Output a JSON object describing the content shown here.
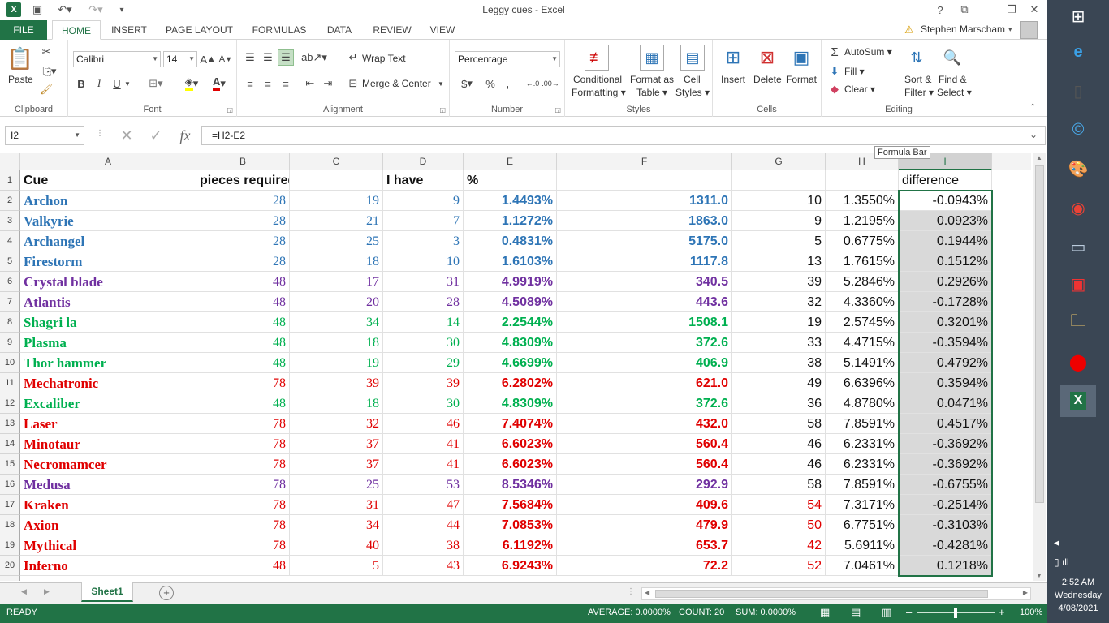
{
  "window": {
    "title": "Leggy cues - Excel"
  },
  "quick_access": {
    "logo": "X"
  },
  "title_controls": {
    "help": "?",
    "restore": "⧉",
    "minimize": "–",
    "maximize": "❐",
    "close": "✕"
  },
  "tabs": [
    "FILE",
    "HOME",
    "INSERT",
    "PAGE LAYOUT",
    "FORMULAS",
    "DATA",
    "REVIEW",
    "VIEW"
  ],
  "user": {
    "name": "Stephen Marscham"
  },
  "ribbon": {
    "clipboard": {
      "label": "Clipboard",
      "paste": "Paste"
    },
    "font": {
      "label": "Font",
      "name": "Calibri",
      "size": "14",
      "bold": "B",
      "italic": "I",
      "underline": "U"
    },
    "alignment": {
      "label": "Alignment",
      "wrap": "Wrap Text",
      "merge": "Merge & Center"
    },
    "number": {
      "label": "Number",
      "format": "Percentage",
      "currency": "$",
      "percent": "%",
      "comma": ","
    },
    "styles": {
      "label": "Styles",
      "conditional": "Conditional",
      "conditional2": "Formatting",
      "format_as": "Format as",
      "format_as2": "Table",
      "cell": "Cell",
      "cell2": "Styles"
    },
    "cells": {
      "label": "Cells",
      "insert": "Insert",
      "delete": "Delete",
      "format": "Format"
    },
    "editing": {
      "label": "Editing",
      "autosum": "AutoSum",
      "fill": "Fill",
      "clear": "Clear",
      "sort": "Sort &",
      "sort2": "Filter",
      "find": "Find &",
      "find2": "Select"
    }
  },
  "formula_bar": {
    "name_box": "I2",
    "formula": "=H2-E2",
    "fx": "fx",
    "tooltip": "Formula Bar"
  },
  "columns": [
    "A",
    "B",
    "C",
    "D",
    "E",
    "F",
    "G",
    "H",
    "I"
  ],
  "header_row": {
    "a": "Cue",
    "b": "pieces required",
    "d": "I have",
    "e": "%",
    "i": "difference"
  },
  "rows": [
    {
      "n": "2",
      "name": "Archon",
      "b": "28",
      "c": "19",
      "d": "9",
      "e": "1.4493%",
      "f": "1311.0",
      "g": "10",
      "h": "1.3550%",
      "i": "-0.0943%",
      "color": "blue"
    },
    {
      "n": "3",
      "name": "Valkyrie",
      "b": "28",
      "c": "21",
      "d": "7",
      "e": "1.1272%",
      "f": "1863.0",
      "g": "9",
      "h": "1.2195%",
      "i": "0.0923%",
      "color": "blue"
    },
    {
      "n": "4",
      "name": "Archangel",
      "b": "28",
      "c": "25",
      "d": "3",
      "e": "0.4831%",
      "f": "5175.0",
      "g": "5",
      "h": "0.6775%",
      "i": "0.1944%",
      "color": "blue"
    },
    {
      "n": "5",
      "name": "Firestorm",
      "b": "28",
      "c": "18",
      "d": "10",
      "e": "1.6103%",
      "f": "1117.8",
      "g": "13",
      "h": "1.7615%",
      "i": "0.1512%",
      "color": "blue"
    },
    {
      "n": "6",
      "name": "Crystal blade",
      "b": "48",
      "c": "17",
      "d": "31",
      "e": "4.9919%",
      "f": "340.5",
      "g": "39",
      "h": "5.2846%",
      "i": "0.2926%",
      "color": "purple"
    },
    {
      "n": "7",
      "name": "Atlantis",
      "b": "48",
      "c": "20",
      "d": "28",
      "e": "4.5089%",
      "f": "443.6",
      "g": "32",
      "h": "4.3360%",
      "i": "-0.1728%",
      "color": "purple"
    },
    {
      "n": "8",
      "name": "Shagri la",
      "b": "48",
      "c": "34",
      "d": "14",
      "e": "2.2544%",
      "f": "1508.1",
      "g": "19",
      "h": "2.5745%",
      "i": "0.3201%",
      "color": "green"
    },
    {
      "n": "9",
      "name": "Plasma",
      "b": "48",
      "c": "18",
      "d": "30",
      "e": "4.8309%",
      "f": "372.6",
      "g": "33",
      "h": "4.4715%",
      "i": "-0.3594%",
      "color": "green"
    },
    {
      "n": "10",
      "name": "Thor hammer",
      "b": "48",
      "c": "19",
      "d": "29",
      "e": "4.6699%",
      "f": "406.9",
      "g": "38",
      "h": "5.1491%",
      "i": "0.4792%",
      "color": "green"
    },
    {
      "n": "11",
      "name": "Mechatronic",
      "b": "78",
      "c": "39",
      "d": "39",
      "e": "6.2802%",
      "f": "621.0",
      "g": "49",
      "h": "6.6396%",
      "i": "0.3594%",
      "color": "red"
    },
    {
      "n": "12",
      "name": "Excaliber",
      "b": "48",
      "c": "18",
      "d": "30",
      "e": "4.8309%",
      "f": "372.6",
      "g": "36",
      "h": "4.8780%",
      "i": "0.0471%",
      "color": "green"
    },
    {
      "n": "13",
      "name": "Laser",
      "b": "78",
      "c": "32",
      "d": "46",
      "e": "7.4074%",
      "f": "432.0",
      "g": "58",
      "h": "7.8591%",
      "i": "0.4517%",
      "color": "red"
    },
    {
      "n": "14",
      "name": "Minotaur",
      "b": "78",
      "c": "37",
      "d": "41",
      "e": "6.6023%",
      "f": "560.4",
      "g": "46",
      "h": "6.2331%",
      "i": "-0.3692%",
      "color": "red"
    },
    {
      "n": "15",
      "name": "Necromamcer",
      "b": "78",
      "c": "37",
      "d": "41",
      "e": "6.6023%",
      "f": "560.4",
      "g": "46",
      "h": "6.2331%",
      "i": "-0.3692%",
      "color": "red"
    },
    {
      "n": "16",
      "name": "Medusa",
      "b": "78",
      "c": "25",
      "d": "53",
      "e": "8.5346%",
      "f": "292.9",
      "g": "58",
      "h": "7.8591%",
      "i": "-0.6755%",
      "color": "purple"
    },
    {
      "n": "17",
      "name": "Kraken",
      "b": "78",
      "c": "31",
      "d": "47",
      "e": "7.5684%",
      "f": "409.6",
      "g": "54",
      "h": "7.3171%",
      "i": "-0.2514%",
      "color": "red",
      "g_red": true
    },
    {
      "n": "18",
      "name": "Axion",
      "b": "78",
      "c": "34",
      "d": "44",
      "e": "7.0853%",
      "f": "479.9",
      "g": "50",
      "h": "6.7751%",
      "i": "-0.3103%",
      "color": "red",
      "g_red": true
    },
    {
      "n": "19",
      "name": "Mythical",
      "b": "78",
      "c": "40",
      "d": "38",
      "e": "6.1192%",
      "f": "653.7",
      "g": "42",
      "h": "5.6911%",
      "i": "-0.4281%",
      "color": "red",
      "g_red": true
    },
    {
      "n": "20",
      "name": "Inferno",
      "b": "48",
      "c": "5",
      "d": "43",
      "e": "6.9243%",
      "f": "72.2",
      "g": "52",
      "h": "7.0461%",
      "i": "0.1218%",
      "color": "red",
      "g_red": true
    }
  ],
  "sheets": {
    "active": "Sheet1",
    "add": "+"
  },
  "status": {
    "ready": "READY",
    "average": "AVERAGE: 0.0000%",
    "count": "COUNT: 20",
    "sum": "SUM: 0.0000%",
    "zoom": "100%"
  },
  "tray": {
    "time": "2:52 AM",
    "day": "Wednesday",
    "date": "4/08/2021"
  },
  "colors": {
    "excel_green": "#217346",
    "blue": "#2e75b6",
    "purple": "#7030a0",
    "green": "#00b050",
    "red": "#e00000"
  }
}
